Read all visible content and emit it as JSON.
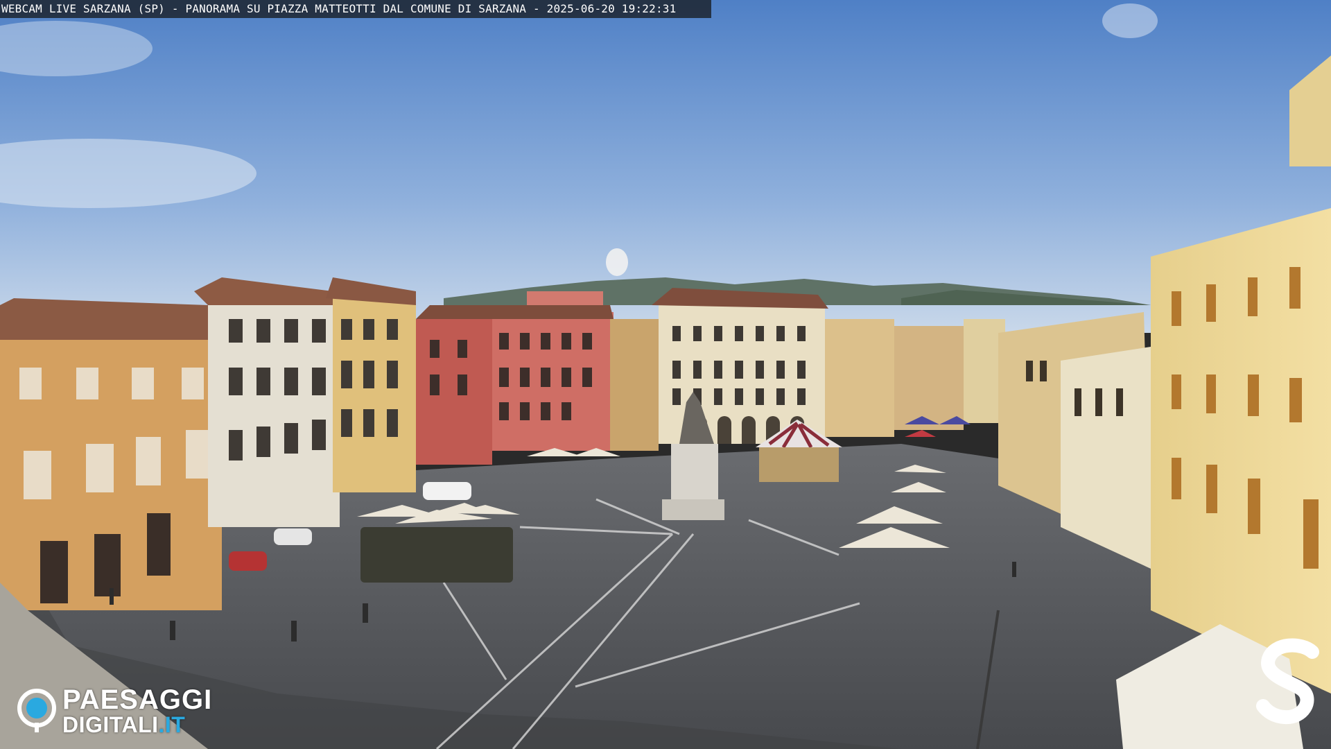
{
  "overlay": {
    "title": "WEBCAM LIVE SARZANA (SP) - PANORAMA SU PIAZZA MATTEOTTI DAL COMUNE DI SARZANA - 2025-06-20  19:22:31"
  },
  "logo": {
    "line1": "PAESAGGI",
    "line2_a": "DIGITALI",
    "line2_b": ".IT",
    "accent_color": "#2aa9e0"
  },
  "watermark": {
    "icon": "s-logo-icon"
  },
  "colors": {
    "sky_top": "#5a86c7",
    "sky_bottom": "#b9cfe6",
    "pavement": "#56585c",
    "building_ochre": "#d7a766",
    "building_red": "#c8645a",
    "building_cream": "#e9e0c6"
  }
}
